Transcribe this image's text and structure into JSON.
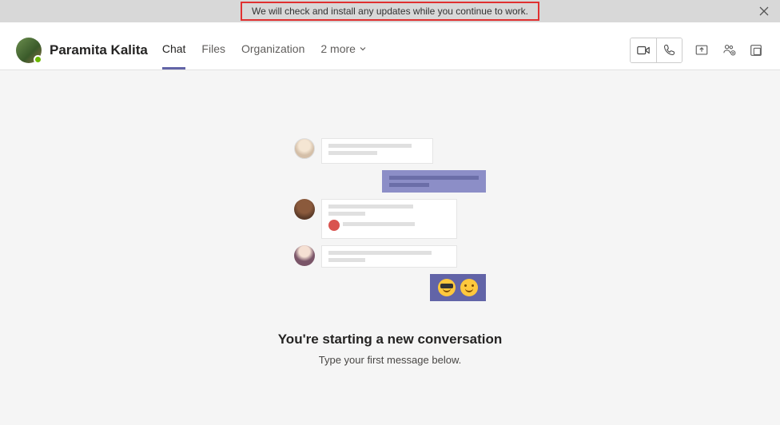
{
  "banner": {
    "text": "We will check and install any updates while you continue to work."
  },
  "contact": {
    "name": "Paramita Kalita"
  },
  "tabs": {
    "chat": "Chat",
    "files": "Files",
    "organization": "Organization",
    "more": "2 more"
  },
  "empty_state": {
    "title": "You're starting a new conversation",
    "subtitle": "Type your first message below."
  }
}
